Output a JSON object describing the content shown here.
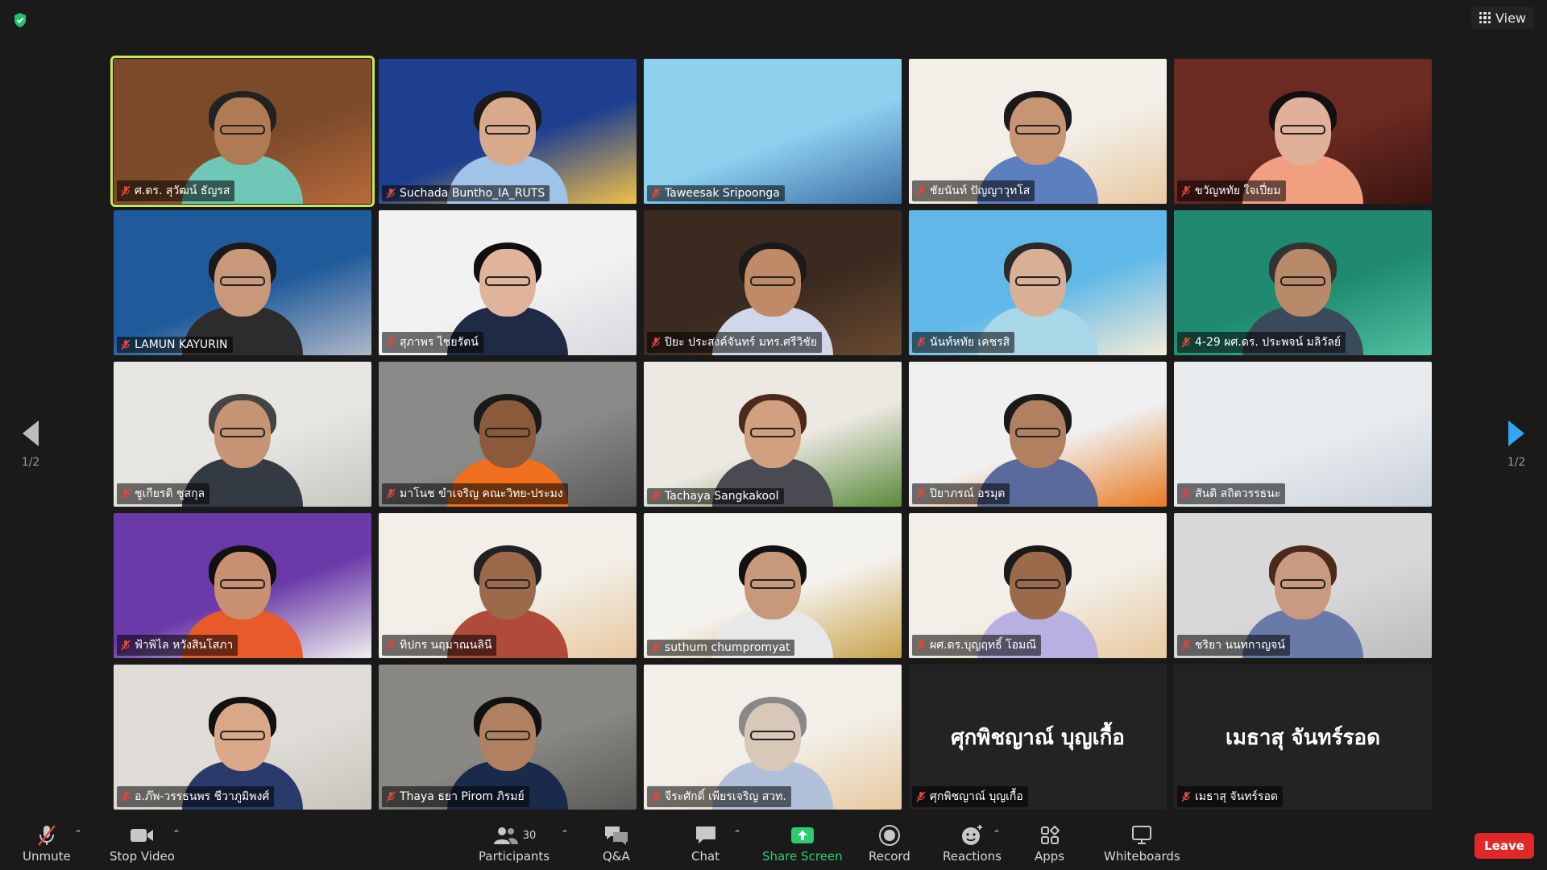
{
  "top": {
    "view_label": "View"
  },
  "nav": {
    "left_page": "1/2",
    "right_page": "1/2"
  },
  "tiles": [
    {
      "name": "ศ.ดร. สุวัฒน์ ธัญรส",
      "bg": "#7a4a2a",
      "bg2": "#b86a3a",
      "skin": "#b07a55",
      "hair": "#222",
      "shirt": "#6fc7b8",
      "active": true
    },
    {
      "name": "Suchada Buntho_IA_RUTS",
      "bg": "#1e3f8f",
      "bg2": "#f2c048",
      "skin": "#d8a98a",
      "hair": "#1a1a1a",
      "shirt": "#9fc4e8"
    },
    {
      "name": "Taweesak Sripoonga",
      "bg": "#8fd0ef",
      "bg2": "#3c6fa5",
      "none": true
    },
    {
      "name": "ชัยนันท์ ปัญญาวุทโส",
      "bg": "#f2efe8",
      "bg2": "#e8c9a0",
      "skin": "#c89574",
      "hair": "#1a1a1a",
      "shirt": "#5b7fbf"
    },
    {
      "name": "ขวัญหทัย ใจเปี่ยม",
      "bg": "#6b2a22",
      "bg2": "#3a1410",
      "skin": "#e0b09a",
      "hair": "#111",
      "shirt": "#f0a080"
    },
    {
      "name": "LAMUN KAYURIN",
      "bg": "#1f5a9a",
      "bg2": "#b0b8c8",
      "skin": "#c9987a",
      "hair": "#1a1a1a",
      "shirt": "#2c2c2c"
    },
    {
      "name": "สุภาพร ไชยรัตน์",
      "bg": "#f2f2f2",
      "bg2": "#d8d8e0",
      "skin": "#e0b49a",
      "hair": "#0f0f0f",
      "shirt": "#1f2a44"
    },
    {
      "name": "ปิยะ ประสงค์จันทร์ มทร.ศรีวิชัย",
      "bg": "#3a2a20",
      "bg2": "#6a4a30",
      "skin": "#c08a66",
      "hair": "#1a1a1a",
      "shirt": "#cfd7e8"
    },
    {
      "name": "นันท์หทัย เคชรสิ",
      "bg": "#5fb8e8",
      "bg2": "#f4ecd8",
      "skin": "#d8b098",
      "hair": "#2a2a2a",
      "shirt": "#a8d8e8"
    },
    {
      "name": "4-29 ผศ.ดร. ประพจน์ มลิวัลย์",
      "bg": "#1f8a6f",
      "bg2": "#4fc1a0",
      "skin": "#b88a6a",
      "hair": "#333",
      "shirt": "#3a4a5a"
    },
    {
      "name": "ชูเกียรติ ชูสกุล",
      "bg": "#e8e6e2",
      "bg2": "#c8c6c2",
      "skin": "#c49474",
      "hair": "#444",
      "shirt": "#333a44"
    },
    {
      "name": "มาโนช ขำเจริญ คณะวิทย-ประมง",
      "bg": "#8a8a88",
      "bg2": "#5a5a58",
      "skin": "#8a5a3a",
      "hair": "#1a1a1a",
      "shirt": "#f07020"
    },
    {
      "name": "Tachaya Sangkakool",
      "bg": "#ece8e2",
      "bg2": "#5a8a3a",
      "skin": "#d0a080",
      "hair": "#4a2a1a",
      "shirt": "#4a4a52"
    },
    {
      "name": "ปิยาภรณ์ อรมุต",
      "bg": "#f0f0f0",
      "bg2": "#e87a20",
      "skin": "#b08060",
      "hair": "#1a1a1a",
      "shirt": "#5a6a9a"
    },
    {
      "name": "สันติ สถิตวรรธนะ",
      "bg": "#e8ecef",
      "bg2": "#c8d0d8",
      "none": true
    },
    {
      "name": "ฟ้าพิไล หวังสินโสภา",
      "bg": "#6a3aa8",
      "bg2": "#f0f0f0",
      "skin": "#c89070",
      "hair": "#111",
      "shirt": "#e85a2a"
    },
    {
      "name": "ทิปกร นฤมาณนลินี",
      "bg": "#f2efe8",
      "bg2": "#e8c9a0",
      "skin": "#9a6a4a",
      "hair": "#222",
      "shirt": "#b04a3a"
    },
    {
      "name": "suthum chumpromyat",
      "bg": "#f4f2ec",
      "bg2": "#c8a24a",
      "skin": "#c8987a",
      "hair": "#111",
      "shirt": "#e8e8e8"
    },
    {
      "name": "ผศ.ดร.บุญฤทธิ์ โอมณี",
      "bg": "#f2efe8",
      "bg2": "#e8c9a0",
      "skin": "#9a6a4a",
      "hair": "#1a1a1a",
      "shirt": "#b8b0e0"
    },
    {
      "name": "ชริยา นนทกาญจน์",
      "bg": "#d8d8d8",
      "bg2": "#bcbcbc",
      "skin": "#c89a80",
      "hair": "#4a2a1a",
      "shirt": "#6a7aa8"
    },
    {
      "name": "อ.ภ๊พ-วรรธนพร ชีวาภูมิพงศ์",
      "bg": "#e0ddd8",
      "bg2": "#c8c4bc",
      "skin": "#d8a888",
      "hair": "#111",
      "shirt": "#2a3a6a"
    },
    {
      "name": "Thaya ธยา Pirom ภิรมย์",
      "bg": "#8a8884",
      "bg2": "#5c5a56",
      "skin": "#b08060",
      "hair": "#111",
      "shirt": "#1a2a4a"
    },
    {
      "name": "จีระศักดิ์ เพียรเจริญ สวท.",
      "bg": "#f2efe8",
      "bg2": "#e8c9a0",
      "skin": "#d8c8b8",
      "hair": "#888",
      "shirt": "#b0c0d8"
    },
    {
      "name": "ศุกพิชญาณ์ บุญเกื้อ",
      "display": "ศุกพิชญาณ์ บุญเกื้อ",
      "nameonly": true
    },
    {
      "name": "เมธาสุ จันทร์รอด",
      "display": "เมธาสุ จันทร์รอด",
      "nameonly": true
    }
  ],
  "toolbar": {
    "unmute": "Unmute",
    "stop_video": "Stop Video",
    "participants": "Participants",
    "participants_count": "30",
    "qa": "Q&A",
    "chat": "Chat",
    "share_screen": "Share Screen",
    "record": "Record",
    "reactions": "Reactions",
    "apps": "Apps",
    "whiteboards": "Whiteboards",
    "leave": "Leave"
  },
  "colors": {
    "accent_green": "#2ecc71",
    "leave_red": "#e02828",
    "active_border": "#c8e65a",
    "muted_red": "#e0463c"
  }
}
